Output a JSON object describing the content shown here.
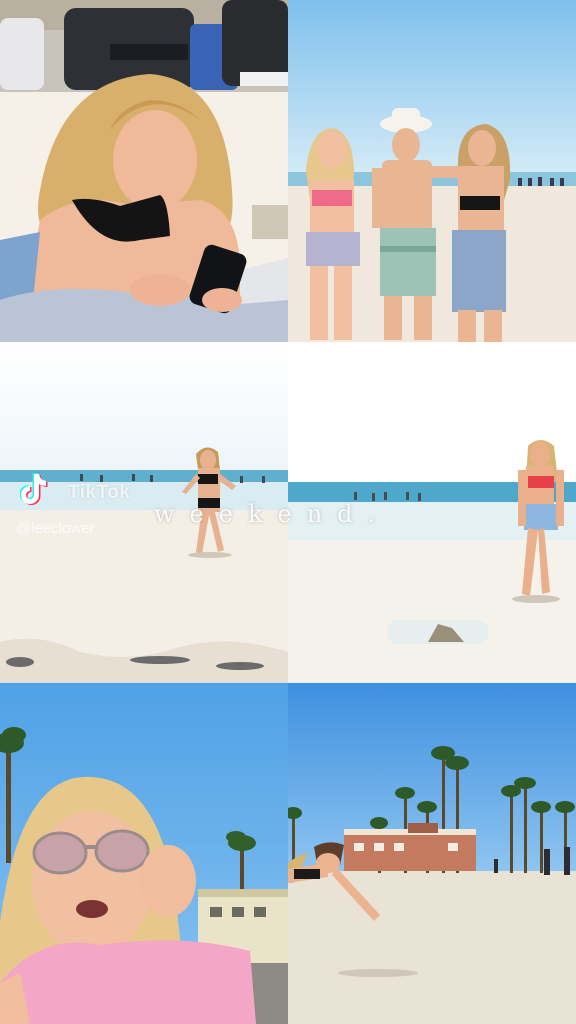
{
  "overlay": {
    "tiktok_wordmark": "TikTok",
    "handle": "@leeclower",
    "caption": "weekend."
  },
  "tiles": [
    {
      "id": "girl-phone-on-towel"
    },
    {
      "id": "three-teens-beach"
    },
    {
      "id": "girl-walking-shore"
    },
    {
      "id": "girl-red-bikini-walking"
    },
    {
      "id": "girl-sunglasses-closeup"
    },
    {
      "id": "backflip-beach-palms"
    }
  ],
  "colors": {
    "sky": "#5aa8e8",
    "sand": "#efe7da",
    "ocean": "#7ec3dc",
    "pink_shirt": "#f3a6c6"
  }
}
